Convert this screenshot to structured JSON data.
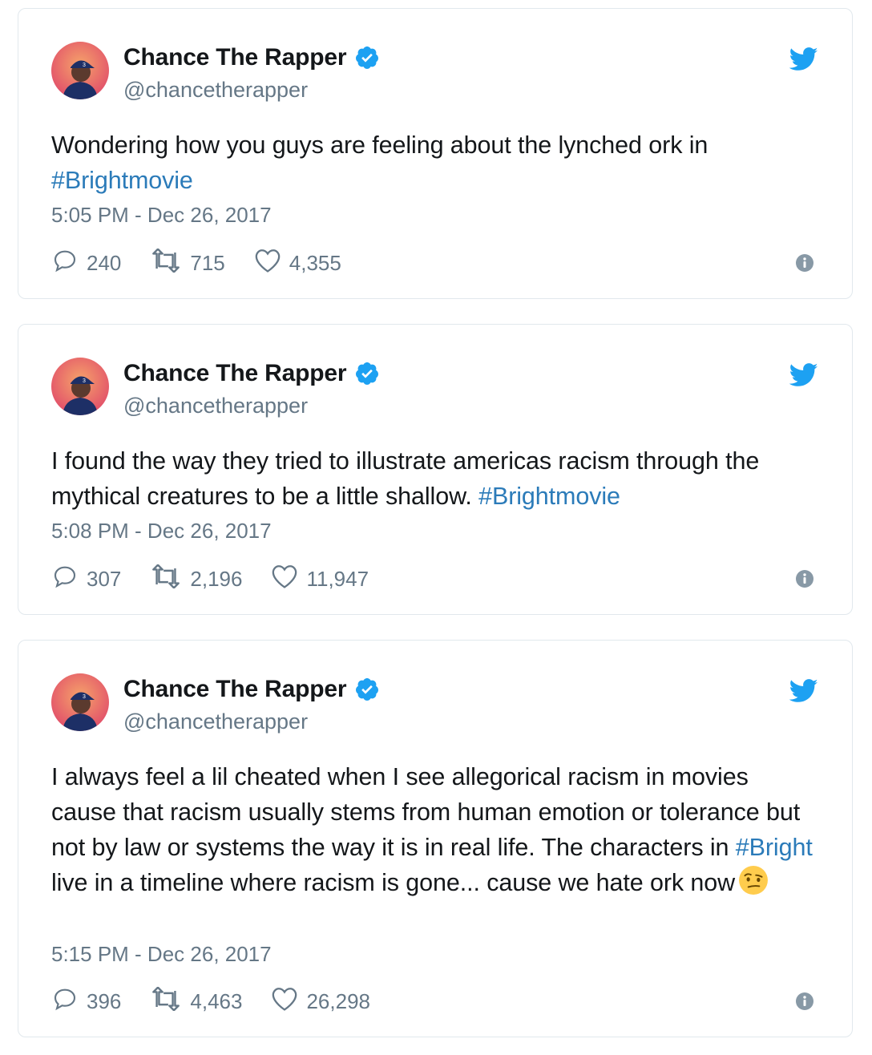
{
  "tweets": [
    {
      "author": {
        "name": "Chance The Rapper",
        "handle": "@chancetherapper"
      },
      "text_parts": [
        {
          "text": "Wondering how you guys are feeling about the lynched ork in ",
          "type": "text"
        },
        {
          "text": "#Brightmovie",
          "type": "hashtag"
        }
      ],
      "timestamp": "5:05 PM - Dec 26, 2017",
      "replies": "240",
      "retweets": "715",
      "likes": "4,355"
    },
    {
      "author": {
        "name": "Chance The Rapper",
        "handle": "@chancetherapper"
      },
      "text_parts": [
        {
          "text": "I found the way they tried to illustrate americas racism through the mythical creatures to be a little shallow. ",
          "type": "text"
        },
        {
          "text": "#Brightmovie",
          "type": "hashtag"
        }
      ],
      "timestamp": "5:08 PM - Dec 26, 2017",
      "replies": "307",
      "retweets": "2,196",
      "likes": "11,947"
    },
    {
      "author": {
        "name": "Chance The Rapper",
        "handle": "@chancetherapper"
      },
      "text_parts": [
        {
          "text": "I always feel a lil cheated when I see allegorical racism in movies cause that racism usually stems from human emotion or tolerance but not by law or systems the way it is in real life. The characters in ",
          "type": "text"
        },
        {
          "text": "#Bright",
          "type": "hashtag"
        },
        {
          "text": " live in a timeline where racism is gone... cause we hate ork now",
          "type": "text"
        }
      ],
      "emoji": "face-with-raised-eyebrow-emoji",
      "timestamp": "5:15 PM - Dec 26, 2017",
      "replies": "396",
      "retweets": "4,463",
      "likes": "26,298"
    }
  ],
  "colors": {
    "link": "#2b7bb9",
    "secondary_text": "#657786",
    "verified_blue": "#1da1f2",
    "border": "#e1e8ed"
  },
  "icons": [
    "twitter-bird-icon",
    "verified-badge-icon",
    "reply-icon",
    "retweet-icon",
    "like-icon",
    "info-icon"
  ]
}
